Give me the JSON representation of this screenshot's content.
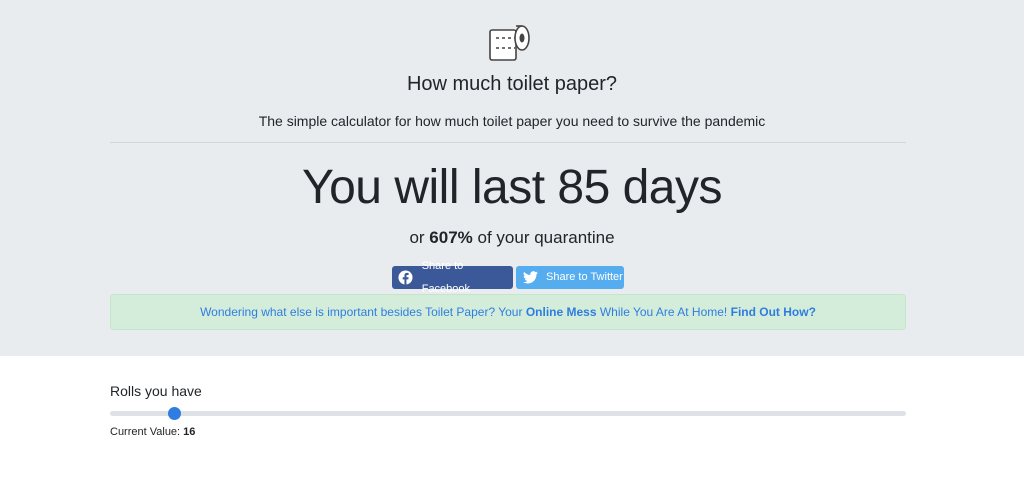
{
  "header": {
    "logo_icon": "toilet-paper-icon",
    "title": "How much toilet paper?",
    "subtitle": "The simple calculator for how much toilet paper you need to survive the pandemic"
  },
  "result": {
    "prefix": "You will last",
    "days": "85",
    "suffix": "days",
    "pct_prefix": "or",
    "percent": "607%",
    "pct_suffix": "of your quarantine"
  },
  "share": {
    "facebook_label": "Share to Facebook",
    "facebook_icon": "facebook-icon",
    "facebook_color": "#3b5998",
    "twitter_label": "Share to Twitter",
    "twitter_icon": "twitter-icon",
    "twitter_color": "#55acee"
  },
  "promo": {
    "text_before": "Wondering what else is important besides Toilet Paper? Your",
    "bold1": "Online Mess",
    "text_middle": "While You Are At Home!",
    "link": "Find Out How?",
    "background": "#d4edda",
    "text_color": "#2f7de1"
  },
  "controls": {
    "rolls_label": "Rolls you have",
    "current_label": "Current Value:",
    "current_value": "16",
    "slider_fraction": 0.08,
    "accent": "#2f7de1"
  }
}
